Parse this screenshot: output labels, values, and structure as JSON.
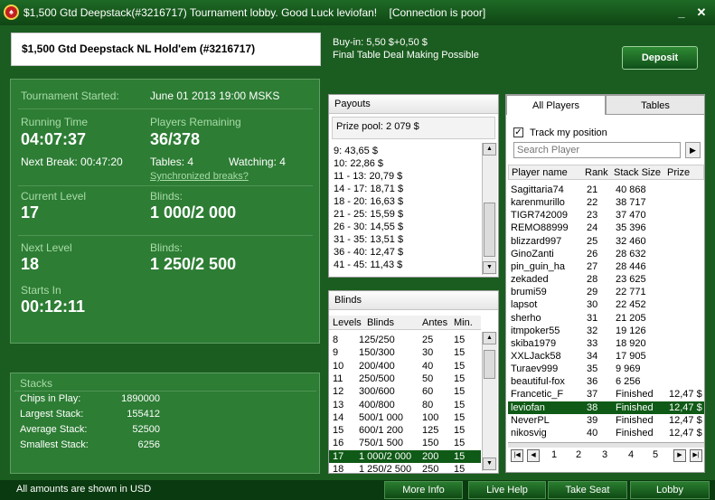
{
  "window": {
    "title": "$1,500 Gtd Deepstack(#3216717) Tournament lobby. Good Luck leviofan!",
    "connection": "[Connection is poor]"
  },
  "header": {
    "tournament_name": "$1,500 Gtd Deepstack NL Hold'em (#3216717)",
    "buy_in": "Buy-in: 5,50 $+0,50 $",
    "deal_text": "Final Table Deal Making Possible",
    "deposit_label": "Deposit"
  },
  "tournament": {
    "started_label": "Tournament Started:",
    "started_value": "June 01 2013  19:00 MSKS",
    "running_label": "Running Time",
    "running_value": "04:07:37",
    "players_label": "Players Remaining",
    "players_value": "36/378",
    "next_break": "Next Break: 00:47:20",
    "tables": "Tables: 4",
    "watching": "Watching: 4",
    "sync_link": "Synchronized breaks?",
    "current_level_label": "Current Level",
    "current_level_value": "17",
    "blinds_label": "Blinds:",
    "current_blinds": "1 000/2 000",
    "next_level_label": "Next Level",
    "next_level_value": "18",
    "next_blinds": "1 250/2 500",
    "starts_in_label": "Starts In",
    "starts_in_value": "00:12:11"
  },
  "stacks": {
    "title": "Stacks",
    "rows": [
      {
        "label": "Chips in Play:",
        "value": "1890000"
      },
      {
        "label": "Largest Stack:",
        "value": "155412"
      },
      {
        "label": "Average Stack:",
        "value": "52500"
      },
      {
        "label": "Smallest Stack:",
        "value": "6256"
      }
    ]
  },
  "payouts": {
    "title": "Payouts",
    "prize_pool": "Prize pool: 2 079 $",
    "rows": [
      "9: 43,65 $",
      "10: 22,86 $",
      "11 - 13: 20,79 $",
      "14 - 17: 18,71 $",
      "18 - 20: 16,63 $",
      "21 - 25: 15,59 $",
      "26 - 30: 14,55 $",
      "31 - 35: 13,51 $",
      "36 - 40: 12,47 $",
      "41 - 45: 11,43 $"
    ]
  },
  "blinds": {
    "title": "Blinds",
    "headers": [
      "Levels",
      "Blinds",
      "Antes",
      "Min."
    ],
    "rows": [
      [
        "8",
        "125/250",
        "25",
        "15"
      ],
      [
        "9",
        "150/300",
        "30",
        "15"
      ],
      [
        "10",
        "200/400",
        "40",
        "15"
      ],
      [
        "11",
        "250/500",
        "50",
        "15"
      ],
      [
        "12",
        "300/600",
        "60",
        "15"
      ],
      [
        "13",
        "400/800",
        "80",
        "15"
      ],
      [
        "14",
        "500/1 000",
        "100",
        "15"
      ],
      [
        "15",
        "600/1 200",
        "125",
        "15"
      ],
      [
        "16",
        "750/1 500",
        "150",
        "15"
      ],
      [
        "17",
        "1 000/2 000",
        "200",
        "15"
      ],
      [
        "18",
        "1 250/2 500",
        "250",
        "15"
      ]
    ],
    "highlight_index": 9
  },
  "players": {
    "tabs": [
      "All Players",
      "Tables"
    ],
    "track_label": "Track my position",
    "search_placeholder": "Search Player",
    "headers": [
      "Player name",
      "Rank",
      "Stack Size",
      "Prize"
    ],
    "rows": [
      [
        "Sagittaria74",
        "21",
        "40 868",
        ""
      ],
      [
        "karenmurillo",
        "22",
        "38 717",
        ""
      ],
      [
        "TIGR742009",
        "23",
        "37 470",
        ""
      ],
      [
        "REMO88999",
        "24",
        "35 396",
        ""
      ],
      [
        "blizzard997",
        "25",
        "32 460",
        ""
      ],
      [
        "GinoZanti",
        "26",
        "28 632",
        ""
      ],
      [
        "pin_guin_ha",
        "27",
        "28 446",
        ""
      ],
      [
        "zekaded",
        "28",
        "23 625",
        ""
      ],
      [
        "brumi59",
        "29",
        "22 771",
        ""
      ],
      [
        "lapsot",
        "30",
        "22 452",
        ""
      ],
      [
        "sherho",
        "31",
        "21 205",
        ""
      ],
      [
        "itmpoker55",
        "32",
        "19 126",
        ""
      ],
      [
        "skiba1979",
        "33",
        "18 920",
        ""
      ],
      [
        "XXLJack58",
        "34",
        "17 905",
        ""
      ],
      [
        "Turaev999",
        "35",
        "9 969",
        ""
      ],
      [
        "beautiful-fox",
        "36",
        "6 256",
        ""
      ],
      [
        "Francetic_F",
        "37",
        "Finished",
        "12,47 $"
      ],
      [
        "leviofan",
        "38",
        "Finished",
        "12,47 $"
      ],
      [
        "NeverPL",
        "39",
        "Finished",
        "12,47 $"
      ],
      [
        "nikosvig",
        "40",
        "Finished",
        "12,47 $"
      ]
    ],
    "highlight_index": 17,
    "pages": [
      "1",
      "2",
      "3",
      "4",
      "5"
    ]
  },
  "footer": {
    "note": "All amounts are shown in USD",
    "buttons": [
      "More Info",
      "Live Help",
      "Take Seat",
      "Lobby"
    ]
  }
}
